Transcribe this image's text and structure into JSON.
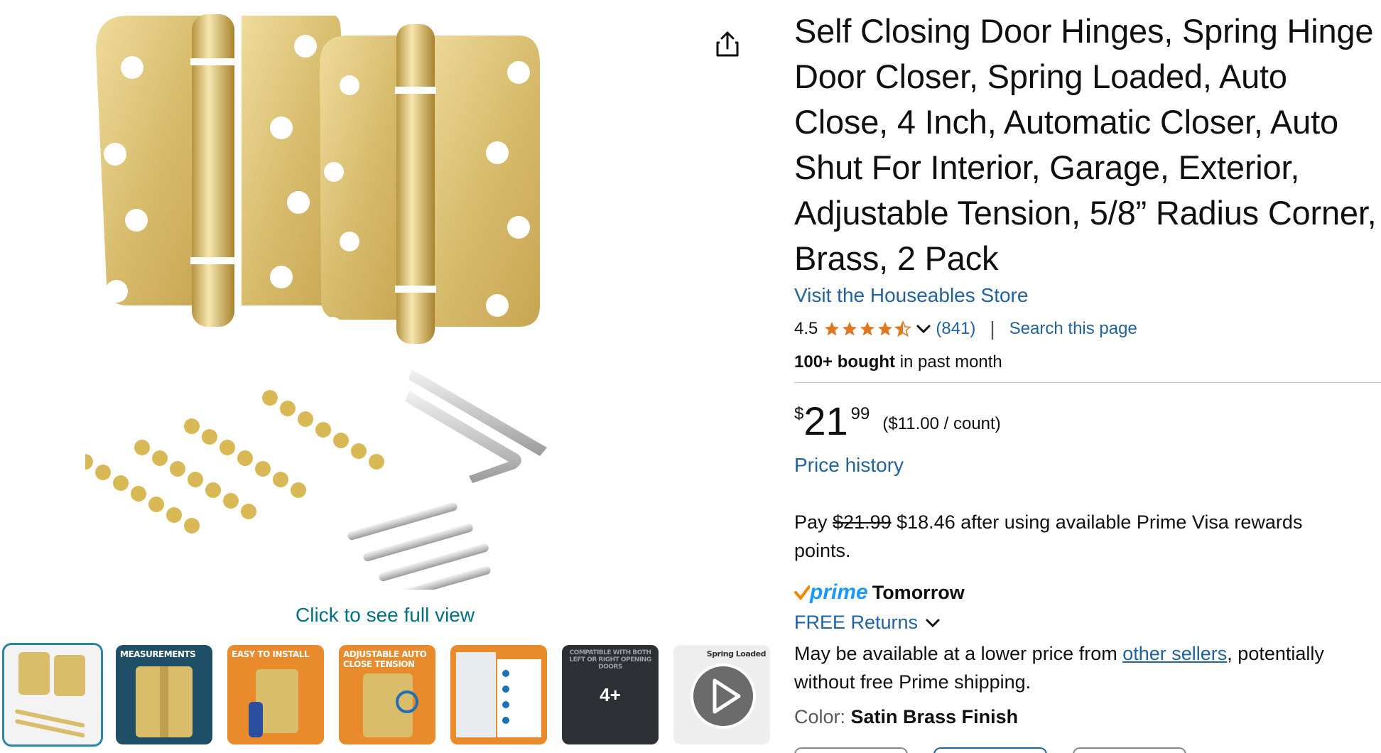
{
  "gallery": {
    "full_view_label": "Click to see full view",
    "share_icon": "share-icon",
    "thumbnails": [
      {
        "label": "",
        "selected": true
      },
      {
        "label": "MEASUREMENTS"
      },
      {
        "label": "EASY TO INSTALL"
      },
      {
        "label": "ADJUSTABLE AUTO CLOSE TENSION"
      },
      {
        "label": ""
      },
      {
        "label": "COMPATIBLE WITH BOTH LEFT OR RIGHT OPENING DOORS",
        "more": "4+"
      },
      {
        "label": "Spring Loaded",
        "is_video": true
      }
    ]
  },
  "product": {
    "title": "Self Closing Door Hinges, Spring Hinge Door Closer, Spring Loaded, Auto Close, 4 Inch, Automatic Closer, Auto Shut For Interior, Garage, Exterior, Adjustable Tension, 5/8” Radius Corner, Brass, 2 Pack",
    "store_link": "Visit the Houseables Store",
    "rating": {
      "value": "4.5",
      "stars": 4.5,
      "count": "(841)"
    },
    "search_page": "Search this page",
    "bought_bold": "100+ bought",
    "bought_rest": " in past month",
    "price": {
      "symbol": "$",
      "whole": "21",
      "fraction": "99",
      "unit": "($11.00 / count)"
    },
    "price_history": "Price history",
    "pay": {
      "prefix": "Pay ",
      "old": "$21.99",
      "rest": " $18.46 after using available Prime Visa rewards points."
    },
    "prime": {
      "word": "prime",
      "day": "Tomorrow"
    },
    "free_returns": "FREE Returns",
    "lower_price": {
      "prefix": "May be available at a lower price from ",
      "link": "other sellers",
      "suffix": ", potentially without free Prime shipping."
    },
    "color": {
      "label": "Color: ",
      "value": "Satin Brass Finish"
    }
  },
  "colors": {
    "link": "#2162a1",
    "star": "#de7921",
    "prime": "#1a98ff",
    "brass": "#d9bd6a"
  }
}
